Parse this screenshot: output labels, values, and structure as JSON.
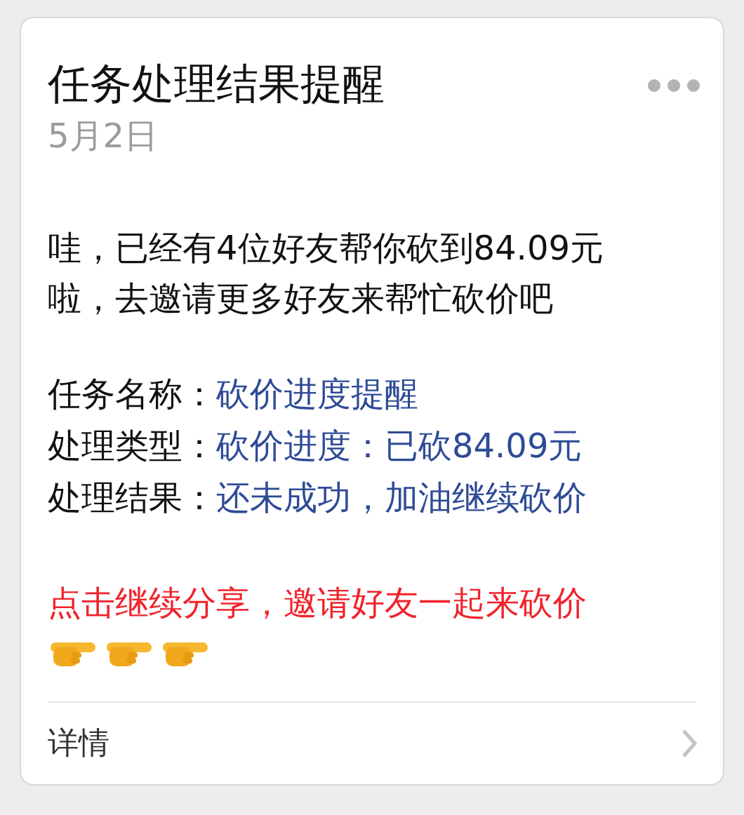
{
  "title": "任务处理结果提醒",
  "date": "5月2日",
  "message": "哇，已经有4位好友帮你砍到84.09元啦，去邀请更多好友来帮忙砍价吧",
  "fields": [
    {
      "label": "任务名称：",
      "value": "砍价进度提醒"
    },
    {
      "label": "处理类型：",
      "value": "砍价进度：已砍84.09元"
    },
    {
      "label": "处理结果：",
      "value": "还未成功，加油继续砍价"
    }
  ],
  "call_to_action": "点击继续分享，邀请好友一起来砍价",
  "decorations": [
    {
      "kind": "pointing-hand"
    },
    {
      "kind": "pointing-hand"
    },
    {
      "kind": "pointing-hand"
    }
  ],
  "details_link": "详情"
}
